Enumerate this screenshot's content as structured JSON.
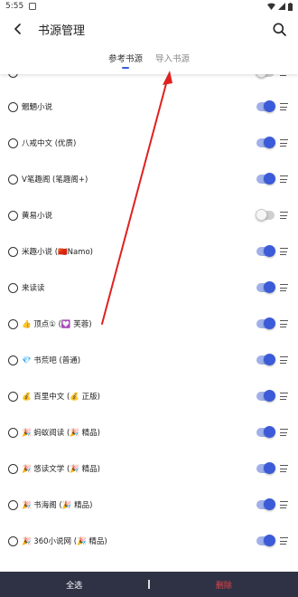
{
  "status_bar": {
    "time": "5:55"
  },
  "header": {
    "title": "书源管理"
  },
  "tabs": [
    {
      "label": "参考书源",
      "active": true
    },
    {
      "label": "导入书源",
      "active": false
    }
  ],
  "sources": [
    {
      "label": "",
      "enabled": false,
      "partial": true
    },
    {
      "label": "魍魉小说",
      "enabled": true
    },
    {
      "label": "八戒中文 (优质)",
      "enabled": true
    },
    {
      "label": "V笔趣阁 (笔趣阁+)",
      "enabled": true
    },
    {
      "label": "黄易小说",
      "enabled": false
    },
    {
      "label": "米趣小说 (🇨🇳Namo)",
      "enabled": true
    },
    {
      "label": "来读读",
      "enabled": true
    },
    {
      "label": "👍 顶点① (💟 芙蓉)",
      "enabled": true
    },
    {
      "label": "💎 书荒吧 (普通)",
      "enabled": true
    },
    {
      "label": "💰 百里中文 (💰 正版)",
      "enabled": true
    },
    {
      "label": "🎉 蚂蚁阅读 (🎉 精品)",
      "enabled": true
    },
    {
      "label": "🎉 悠读文学 (🎉 精品)",
      "enabled": true
    },
    {
      "label": "🎉 书海阁 (🎉 精品)",
      "enabled": true
    },
    {
      "label": "🎉 360小说网 (🎉 精品)",
      "enabled": true
    }
  ],
  "bottom_bar": {
    "select_all": "全选",
    "delete": "删除"
  },
  "colors": {
    "accent": "#3b5bd9",
    "delete": "#e2454a",
    "bottom_bar_bg": "#2f3244",
    "annotation_arrow": "#e02020"
  }
}
